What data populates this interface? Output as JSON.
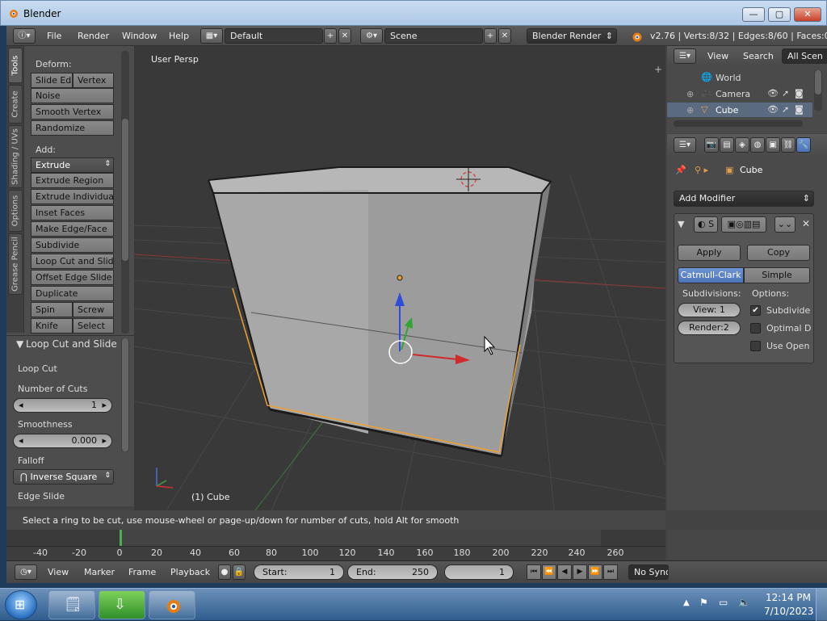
{
  "window": {
    "title": "Blender",
    "minimize": "—",
    "maximize": "▢",
    "close": "✕"
  },
  "header": {
    "menus": [
      "File",
      "Render",
      "Window",
      "Help"
    ],
    "screen_layout": "Default",
    "scene": "Scene",
    "render_engine": "Blender Render",
    "stats": "v2.76 | Verts:8/32 | Edges:8/60 | Faces:0/"
  },
  "tool_tabs": [
    "Tools",
    "Create",
    "Shading / UVs",
    "Options",
    "Grease Pencil"
  ],
  "tools": {
    "deform_label": "Deform:",
    "deform": [
      "Slide Ed",
      "Vertex",
      "Noise",
      "Smooth Vertex",
      "Randomize"
    ],
    "add_label": "Add:",
    "add": [
      "Extrude",
      "Extrude Region",
      "Extrude Individual",
      "Inset Faces",
      "Make Edge/Face",
      "Subdivide",
      "Loop Cut and Slide",
      "Offset Edge Slide",
      "Duplicate",
      "Spin",
      "Screw",
      "Knife",
      "Select"
    ]
  },
  "operator": {
    "title": "Loop Cut and Slide",
    "subtitle": "Loop Cut",
    "cuts_label": "Number of Cuts",
    "cuts_value": "1",
    "smooth_label": "Smoothness",
    "smooth_value": "0.000",
    "falloff_label": "Falloff",
    "falloff_value": "Inverse Square",
    "edge_slide_label": "Edge Slide"
  },
  "viewport": {
    "persp_label": "User Persp",
    "object_label": "(1) Cube"
  },
  "status": "Select a ring to be cut, use mouse-wheel or page-up/down for number of cuts, hold Alt for smooth",
  "outliner": {
    "view": "View",
    "search": "Search",
    "filter": "All Scen",
    "items": [
      "World",
      "Camera",
      "Cube"
    ]
  },
  "properties": {
    "object_name": "Cube",
    "add_modifier": "Add Modifier",
    "modifier_short": "S",
    "apply": "Apply",
    "copy": "Copy",
    "catmull": "Catmull-Clark",
    "simple": "Simple",
    "subdivisions_label": "Subdivisions:",
    "options_label": "Options:",
    "view_field": "View:  1",
    "render_field": "Render:2",
    "opt_subdivide": "Subdivide",
    "opt_optimal": "Optimal D",
    "opt_useopen": "Use Open"
  },
  "timeline": {
    "ticks": [
      "-40",
      "-20",
      "0",
      "20",
      "40",
      "60",
      "80",
      "100",
      "120",
      "140",
      "160",
      "180",
      "200",
      "220",
      "240",
      "260"
    ],
    "menus": [
      "View",
      "Marker",
      "Frame",
      "Playback"
    ],
    "start_label": "Start:",
    "start_value": "1",
    "end_label": "End:",
    "end_value": "250",
    "current": "1",
    "sync": "No Sync"
  },
  "taskbar": {
    "time": "12:14 PM",
    "date": "7/10/2023"
  },
  "colors": {
    "accent_blue": "#5680c2",
    "selected_orange": "#f0a030",
    "grid": "#4a4a4a"
  }
}
